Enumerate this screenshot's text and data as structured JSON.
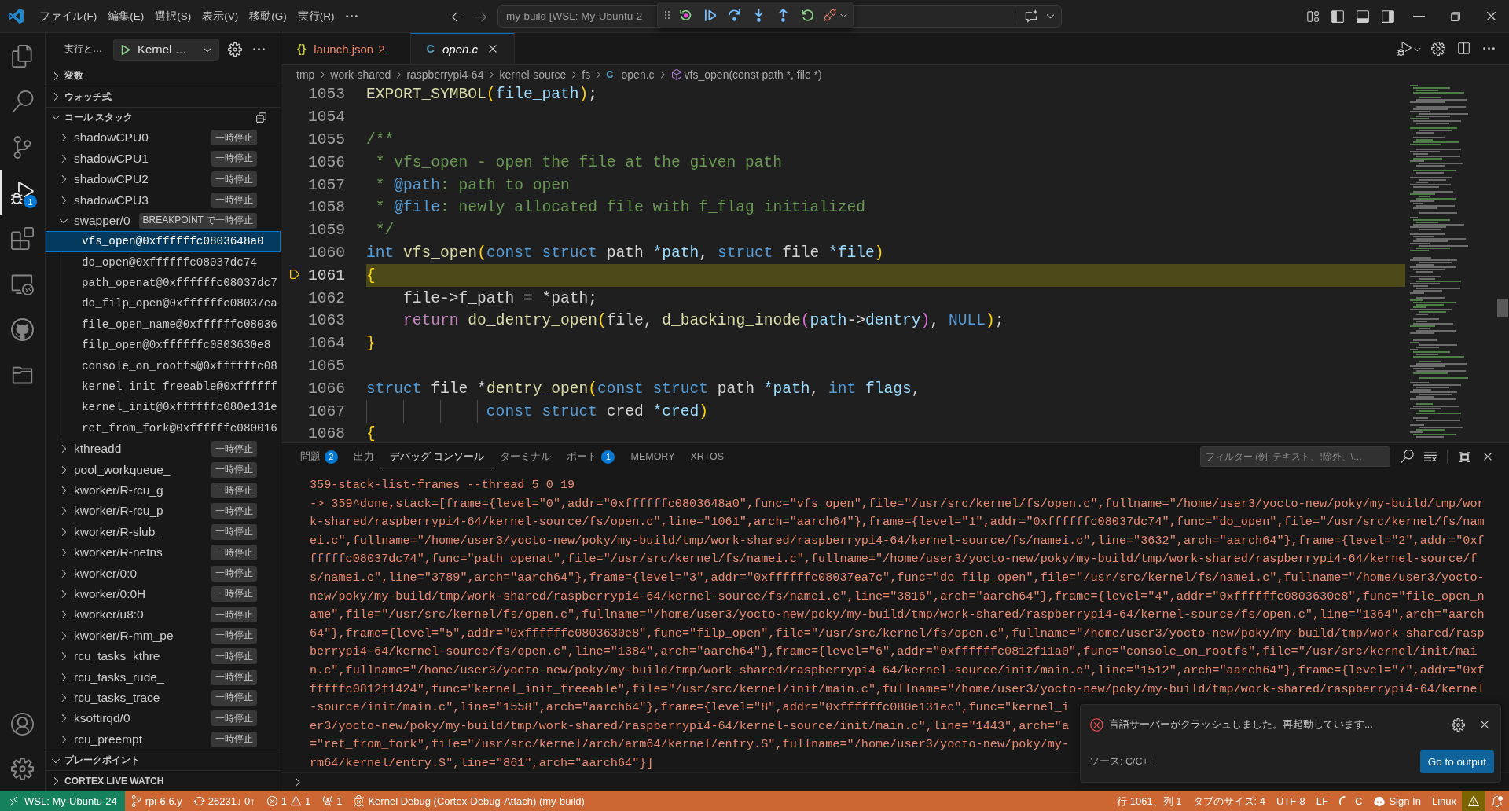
{
  "title_bar": {
    "menus": [
      "ファイル(F)",
      "編集(E)",
      "選択(S)",
      "表示(V)",
      "移動(G)",
      "実行(R)"
    ],
    "command_center": "my-build [WSL: My-Ubuntu-2"
  },
  "activity_bar": {
    "items": [
      {
        "selected": false
      },
      {
        "selected": false
      },
      {
        "selected": false
      },
      {
        "selected": true,
        "badge": "1"
      },
      {
        "selected": false
      },
      {
        "selected": false
      },
      {
        "selected": false
      },
      {
        "selected": false
      }
    ]
  },
  "sidebar": {
    "title": "実行と…",
    "launch_config": "Kernel …",
    "sections": [
      {
        "label": "変数",
        "expanded": false
      },
      {
        "label": "ウォッチ式",
        "expanded": false
      },
      {
        "label": "コール スタック",
        "expanded": true,
        "threads": [
          {
            "name": "shadowCPU0",
            "status": "一時停止",
            "expanded": false
          },
          {
            "name": "shadowCPU1",
            "status": "一時停止",
            "expanded": false
          },
          {
            "name": "shadowCPU2",
            "status": "一時停止",
            "expanded": false
          },
          {
            "name": "shadowCPU3",
            "status": "一時停止",
            "expanded": false
          },
          {
            "name": "swapper/0",
            "status": "BREAKPOINT で一時停止",
            "expanded": true,
            "frames": [
              {
                "label": "vfs_open@0xffffffc0803648a0",
                "selected": true
              },
              {
                "label": "do_open@0xffffffc08037dc74",
                "selected": false
              },
              {
                "label": "path_openat@0xffffffc08037dc7",
                "selected": false
              },
              {
                "label": "do_filp_open@0xffffffc08037ea",
                "selected": false
              },
              {
                "label": "file_open_name@0xffffffc08036",
                "selected": false
              },
              {
                "label": "filp_open@0xffffffc0803630e8",
                "selected": false
              },
              {
                "label": "console_on_rootfs@0xffffffc08",
                "selected": false
              },
              {
                "label": "kernel_init_freeable@0xffffff",
                "selected": false
              },
              {
                "label": "kernel_init@0xffffffc080e131e",
                "selected": false
              },
              {
                "label": "ret_from_fork@0xffffffc080016",
                "selected": false
              }
            ]
          },
          {
            "name": "kthreadd",
            "status": "一時停止",
            "expanded": false
          },
          {
            "name": "pool_workqueue_",
            "status": "一時停止",
            "expanded": false
          },
          {
            "name": "kworker/R-rcu_g",
            "status": "一時停止",
            "expanded": false
          },
          {
            "name": "kworker/R-rcu_p",
            "status": "一時停止",
            "expanded": false
          },
          {
            "name": "kworker/R-slub_",
            "status": "一時停止",
            "expanded": false
          },
          {
            "name": "kworker/R-netns",
            "status": "一時停止",
            "expanded": false
          },
          {
            "name": "kworker/0:0",
            "status": "一時停止",
            "expanded": false
          },
          {
            "name": "kworker/0:0H",
            "status": "一時停止",
            "expanded": false
          },
          {
            "name": "kworker/u8:0",
            "status": "一時停止",
            "expanded": false
          },
          {
            "name": "kworker/R-mm_pe",
            "status": "一時停止",
            "expanded": false
          },
          {
            "name": "rcu_tasks_kthre",
            "status": "一時停止",
            "expanded": false
          },
          {
            "name": "rcu_tasks_rude_",
            "status": "一時停止",
            "expanded": false
          },
          {
            "name": "rcu_tasks_trace",
            "status": "一時停止",
            "expanded": false
          },
          {
            "name": "ksoftirqd/0",
            "status": "一時停止",
            "expanded": false
          },
          {
            "name": "rcu_preempt",
            "status": "一時停止",
            "expanded": false
          }
        ]
      },
      {
        "label": "ブレークポイント",
        "expanded": true
      },
      {
        "label": "CORTEX LIVE WATCH",
        "expanded": false
      }
    ]
  },
  "editor": {
    "tabs": [
      {
        "label": "launch.json",
        "icon_glyph": "{}",
        "kind": "json",
        "problems": "2",
        "preview": false,
        "selected": false
      },
      {
        "label": "open.c",
        "icon_glyph": "C",
        "kind": "c",
        "preview": true,
        "selected": true
      }
    ],
    "breadcrumb": [
      {
        "label": "tmp",
        "kind": "folder"
      },
      {
        "label": "work-shared",
        "kind": "folder"
      },
      {
        "label": "raspberrypi4-64",
        "kind": "folder"
      },
      {
        "label": "kernel-source",
        "kind": "folder"
      },
      {
        "label": "fs",
        "kind": "folder"
      },
      {
        "label": "open.c",
        "kind": "file",
        "icon_glyph": "C"
      },
      {
        "label": "vfs_open(const path *, file *)",
        "kind": "symbol"
      }
    ],
    "lines": [
      {
        "number": "1053",
        "current": false,
        "tokens": [
          {
            "text": "EXPORT_SYMBOL",
            "kind": "function"
          },
          {
            "text": "(",
            "kind": "bracket"
          },
          {
            "text": "file_path",
            "kind": "variable"
          },
          {
            "text": ")",
            "kind": "bracket"
          },
          {
            "text": ";",
            "kind": "plain"
          }
        ]
      },
      {
        "number": "1054",
        "current": false
      },
      {
        "number": "1055",
        "current": false,
        "tokens": [
          {
            "text": "/**",
            "kind": "comment"
          }
        ]
      },
      {
        "number": "1056",
        "current": false,
        "tokens": [
          {
            "text": " * vfs_open - open the file at the given path",
            "kind": "comment"
          }
        ]
      },
      {
        "number": "1057",
        "current": false,
        "tokens": [
          {
            "text": " * ",
            "kind": "comment"
          },
          {
            "text": "@path",
            "kind": "doc_tag"
          },
          {
            "text": ": path to open",
            "kind": "comment"
          }
        ]
      },
      {
        "number": "1058",
        "current": false,
        "tokens": [
          {
            "text": " * ",
            "kind": "comment"
          },
          {
            "text": "@file",
            "kind": "doc_tag"
          },
          {
            "text": ": newly allocated file with f_flag initialized",
            "kind": "comment"
          }
        ]
      },
      {
        "number": "1059",
        "current": false,
        "tokens": [
          {
            "text": " */",
            "kind": "comment"
          }
        ]
      },
      {
        "number": "1060",
        "current": false,
        "tokens": [
          {
            "text": "int ",
            "kind": "keyword"
          },
          {
            "text": "vfs_open",
            "kind": "function"
          },
          {
            "text": "(",
            "kind": "bracket"
          },
          {
            "text": "const struct",
            "kind": "keyword"
          },
          {
            "text": " path ",
            "kind": "plain"
          },
          {
            "text": "*path",
            "kind": "parameter"
          },
          {
            "text": ", ",
            "kind": "plain"
          },
          {
            "text": "struct",
            "kind": "keyword"
          },
          {
            "text": " file ",
            "kind": "plain"
          },
          {
            "text": "*file",
            "kind": "parameter"
          },
          {
            "text": ")",
            "kind": "bracket"
          }
        ]
      },
      {
        "number": "1061",
        "current": true,
        "tokens": [
          {
            "text": "{",
            "kind": "bracket"
          }
        ]
      },
      {
        "number": "1062",
        "current": false,
        "guides": false,
        "tokens": [
          {
            "text": "    file->f_path = *path;",
            "kind": "plain"
          }
        ]
      },
      {
        "number": "1063",
        "current": false,
        "guides": false,
        "tokens": [
          {
            "text": "    return ",
            "kind": "control"
          },
          {
            "text": "do_dentry_open",
            "kind": "function"
          },
          {
            "text": "(",
            "kind": "bracket"
          },
          {
            "text": "file, ",
            "kind": "plain"
          },
          {
            "text": "d_backing_inode",
            "kind": "function"
          },
          {
            "text": "(",
            "kind": "bracket2"
          },
          {
            "text": "path",
            "kind": "variable"
          },
          {
            "text": "->",
            "kind": "plain"
          },
          {
            "text": "dentry",
            "kind": "variable"
          },
          {
            "text": ")",
            "kind": "bracket2"
          },
          {
            "text": ", ",
            "kind": "plain"
          },
          {
            "text": "NULL",
            "kind": "constant"
          },
          {
            "text": ")",
            "kind": "bracket"
          },
          {
            "text": ";",
            "kind": "plain"
          }
        ]
      },
      {
        "number": "1064",
        "current": false,
        "tokens": [
          {
            "text": "}",
            "kind": "bracket"
          }
        ]
      },
      {
        "number": "1065",
        "current": false
      },
      {
        "number": "1066",
        "current": false,
        "tokens": [
          {
            "text": "struct",
            "kind": "keyword"
          },
          {
            "text": " file *",
            "kind": "plain"
          },
          {
            "text": "dentry_open",
            "kind": "function"
          },
          {
            "text": "(",
            "kind": "bracket"
          },
          {
            "text": "const struct",
            "kind": "keyword"
          },
          {
            "text": " path ",
            "kind": "plain"
          },
          {
            "text": "*path",
            "kind": "parameter"
          },
          {
            "text": ", ",
            "kind": "plain"
          },
          {
            "text": "int ",
            "kind": "keyword"
          },
          {
            "text": "flags",
            "kind": "parameter"
          },
          {
            "text": ",",
            "kind": "plain"
          }
        ]
      },
      {
        "number": "1067",
        "current": false,
        "guides": true,
        "tokens": [
          {
            "text": "             const struct",
            "kind": "keyword"
          },
          {
            "text": " cred ",
            "kind": "plain"
          },
          {
            "text": "*cred",
            "kind": "parameter"
          },
          {
            "text": ")",
            "kind": "bracket"
          }
        ]
      },
      {
        "number": "1068",
        "current": false,
        "tokens": [
          {
            "text": "{",
            "kind": "bracket"
          }
        ]
      }
    ]
  },
  "panel": {
    "tabs": [
      {
        "label": "問題",
        "badge": "2",
        "selected": false
      },
      {
        "label": "出力",
        "selected": false
      },
      {
        "label": "デバッグ コンソール",
        "selected": true
      },
      {
        "label": "ターミナル",
        "selected": false
      },
      {
        "label": "ポート",
        "badge": "1",
        "selected": false
      },
      {
        "label": "MEMORY",
        "selected": false
      },
      {
        "label": "XRTOS",
        "selected": false
      }
    ],
    "filter": {
      "placeholder": "フィルター (例: テキスト、!除外、\\…"
    },
    "output": [
      "359-stack-list-frames --thread 5 0 19",
      "-> 359^done,stack=[frame={level=\"0\",addr=\"0xffffffc0803648a0\",func=\"vfs_open\",file=\"/usr/src/kernel/fs/open.c\",fullname=\"/home/user3/yocto-new/poky/my-build/tmp/wor",
      "k-shared/raspberrypi4-64/kernel-source/fs/open.c\",line=\"1061\",arch=\"aarch64\"},frame={level=\"1\",addr=\"0xffffffc08037dc74\",func=\"do_open\",file=\"/usr/src/kernel/fs/nam",
      "ei.c\",fullname=\"/home/user3/yocto-new/poky/my-build/tmp/work-shared/raspberrypi4-64/kernel-source/fs/namei.c\",line=\"3632\",arch=\"aarch64\"},frame={level=\"2\",addr=\"0xf",
      "fffffc08037dc74\",func=\"path_openat\",file=\"/usr/src/kernel/fs/namei.c\",fullname=\"/home/user3/yocto-new/poky/my-build/tmp/work-shared/raspberrypi4-64/kernel-source/f",
      "s/namei.c\",line=\"3789\",arch=\"aarch64\"},frame={level=\"3\",addr=\"0xffffffc08037ea7c\",func=\"do_filp_open\",file=\"/usr/src/kernel/fs/namei.c\",fullname=\"/home/user3/yocto-",
      "new/poky/my-build/tmp/work-shared/raspberrypi4-64/kernel-source/fs/namei.c\",line=\"3816\",arch=\"aarch64\"},frame={level=\"4\",addr=\"0xffffffc0803630e8\",func=\"file_open_n",
      "ame\",file=\"/usr/src/kernel/fs/open.c\",fullname=\"/home/user3/yocto-new/poky/my-build/tmp/work-shared/raspberrypi4-64/kernel-source/fs/open.c\",line=\"1364\",arch=\"aarch",
      "64\"},frame={level=\"5\",addr=\"0xffffffc0803630e8\",func=\"filp_open\",file=\"/usr/src/kernel/fs/open.c\",fullname=\"/home/user3/yocto-new/poky/my-build/tmp/work-shared/rasp",
      "berrypi4-64/kernel-source/fs/open.c\",line=\"1384\",arch=\"aarch64\"},frame={level=\"6\",addr=\"0xffffffc0812f11a0\",func=\"console_on_rootfs\",file=\"/usr/src/kernel/init/mai",
      "n.c\",fullname=\"/home/user3/yocto-new/poky/my-build/tmp/work-shared/raspberrypi4-64/kernel-source/init/main.c\",line=\"1512\",arch=\"aarch64\"},frame={level=\"7\",addr=\"0xf",
      "fffffc0812f1424\",func=\"kernel_init_freeable\",file=\"/usr/src/kernel/init/main.c\",fullname=\"/home/user3/yocto-new/poky/my-build/tmp/work-shared/raspberrypi4-64/kernel",
      "-source/init/main.c\",line=\"1558\",arch=\"aarch64\"},frame={level=\"8\",addr=\"0xffffffc080e131ec\",func=\"kernel_i",
      "er3/yocto-new/poky/my-build/tmp/work-shared/raspberrypi4-64/kernel-source/init/main.c\",line=\"1443\",arch=\"a",
      "=\"ret_from_fork\",file=\"/usr/src/kernel/arch/arm64/kernel/entry.S\",fullname=\"/home/user3/yocto-new/poky/my-",
      "rm64/kernel/entry.S\",line=\"861\",arch=\"aarch64\"}]"
    ]
  },
  "notification": {
    "message": "言語サーバーがクラッシュしました。再起動しています...",
    "source": "ソース: C/C++",
    "button": "Go to output"
  },
  "status_bar": {
    "remote": "WSL: My-Ubuntu-24",
    "branch": "rpi-6.6.y",
    "sync": "26231↓ 0↑",
    "errors": "1",
    "warnings": "1",
    "ports": "1",
    "debug_session": "Kernel Debug (Cortex-Debug-Attach) (my-build)",
    "cursor": "行 1061、列 1",
    "tab_size": "タブのサイズ: 4",
    "encoding": "UTF-8",
    "eol": "LF",
    "language": "C",
    "account": "Sign In",
    "platform": "Linux"
  }
}
